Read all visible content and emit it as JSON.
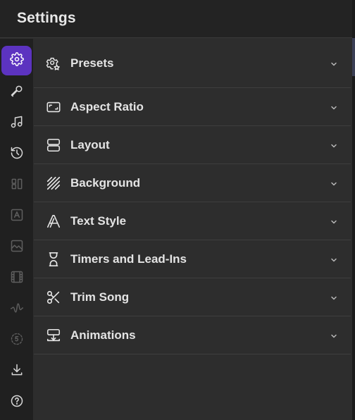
{
  "header": {
    "title": "Settings"
  },
  "rail": {
    "items": [
      {
        "name": "settings",
        "icon": "gear-icon",
        "active": true
      },
      {
        "name": "microphone",
        "icon": "microphone-icon"
      },
      {
        "name": "music",
        "icon": "music-note-icon"
      },
      {
        "name": "history",
        "icon": "history-icon"
      },
      {
        "name": "layout-columns",
        "icon": "columns-icon",
        "dim": true
      },
      {
        "name": "text-box",
        "icon": "text-box-icon",
        "dim": true
      },
      {
        "name": "image",
        "icon": "image-icon",
        "dim": true
      },
      {
        "name": "film",
        "icon": "film-icon",
        "dim": true
      },
      {
        "name": "waveform",
        "icon": "waveform-icon",
        "dim": true
      },
      {
        "name": "countdown",
        "icon": "countdown-5-icon",
        "dim": true
      },
      {
        "name": "download",
        "icon": "download-icon"
      },
      {
        "name": "help",
        "icon": "help-icon"
      }
    ]
  },
  "sections": [
    {
      "label": "Presets",
      "icon": "preset-gear-icon"
    },
    {
      "label": "Aspect Ratio",
      "icon": "aspect-ratio-icon"
    },
    {
      "label": "Layout",
      "icon": "layout-stack-icon"
    },
    {
      "label": "Background",
      "icon": "diagonal-stripes-icon"
    },
    {
      "label": "Text Style",
      "icon": "text-style-icon"
    },
    {
      "label": "Timers and Lead-Ins",
      "icon": "hourglass-icon"
    },
    {
      "label": "Trim Song",
      "icon": "scissors-icon"
    },
    {
      "label": "Animations",
      "icon": "animation-icon"
    }
  ],
  "colors": {
    "accent": "#5c33c0",
    "background": "#2d2d2d",
    "header": "#232323",
    "rail": "#202020",
    "divider": "#3e3e3e",
    "text": "#e4e4e4"
  }
}
